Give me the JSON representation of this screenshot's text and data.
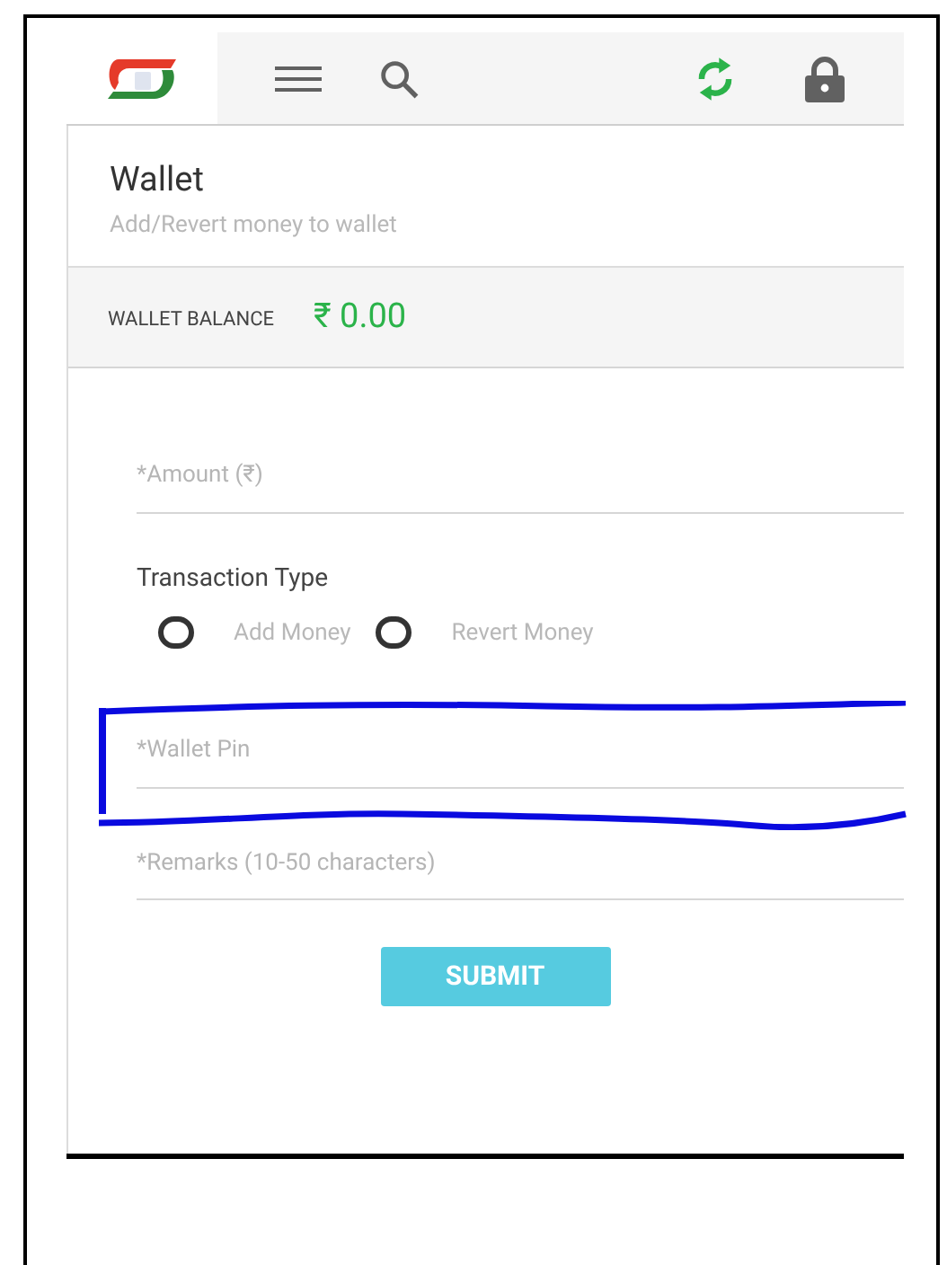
{
  "header": {
    "actions": [
      {
        "kind": "menu"
      },
      {
        "kind": "search"
      },
      {
        "kind": "refresh"
      },
      {
        "kind": "lock"
      }
    ]
  },
  "page": {
    "title": "Wallet",
    "subtitle": "Add/Revert money to wallet"
  },
  "balance": {
    "label": "WALLET BALANCE",
    "value": "₹ 0.00"
  },
  "form": {
    "amount": {
      "placeholder": "*Amount (₹)"
    },
    "transaction_type": {
      "label": "Transaction Type",
      "options": [
        {
          "label": "Add Money",
          "selected": false
        },
        {
          "label": "Revert Money",
          "selected": false
        }
      ]
    },
    "wallet_pin": {
      "placeholder": "*Wallet Pin",
      "highlighted": true
    },
    "remarks": {
      "placeholder": "*Remarks (10-50 characters)"
    },
    "submit": "SUBMIT"
  }
}
